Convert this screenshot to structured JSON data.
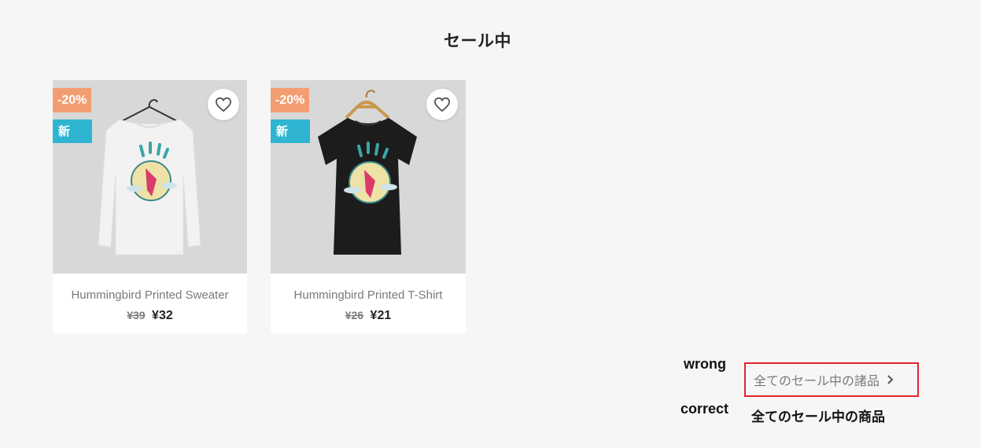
{
  "section": {
    "title": "セール中"
  },
  "products": [
    {
      "name": "Hummingbird Printed Sweater",
      "old_price": "¥39",
      "price": "¥32",
      "discount_flag": "-20%",
      "new_flag": "新",
      "shirt_color": "#f2f2f2"
    },
    {
      "name": "Hummingbird Printed T-Shirt",
      "old_price": "¥26",
      "price": "¥21",
      "discount_flag": "-20%",
      "new_flag": "新",
      "shirt_color": "#1c1c1c"
    }
  ],
  "annotation": {
    "wrong_label": "wrong",
    "wrong_text": "全てのセール中の諸品",
    "correct_label": "correct",
    "correct_text": "全てのセール中の商品"
  },
  "colors": {
    "discount": "#f39d72",
    "new": "#2fb5d2",
    "highlight_box": "#e3242b"
  },
  "icons": {
    "wishlist": "heart-outline-icon",
    "link_arrow": "chevron-right-icon"
  }
}
